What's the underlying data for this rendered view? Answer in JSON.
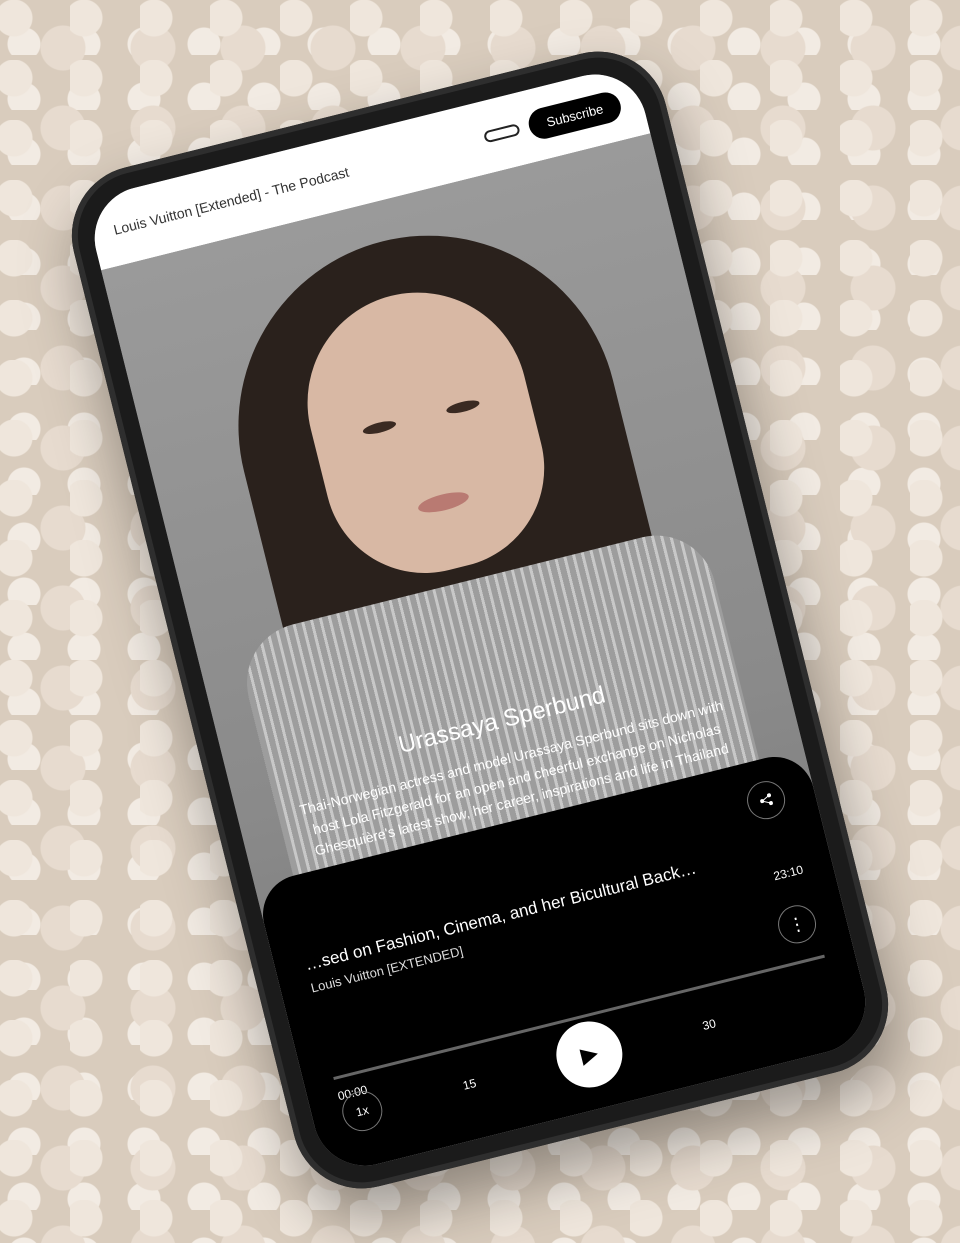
{
  "header": {
    "app_title": "Louis Vuitton [Extended] - The Podcast",
    "small_button_label": "",
    "subscribe_label": "Subscribe"
  },
  "episode": {
    "guest_name": "Urassaya Sperbund",
    "description": "Thai-Norwegian actress and model Urassaya Sperbund sits down with host Lola Fitzgerald for an open and cheerful exchange on Nicholas Ghesquière's latest show, her career, inspirations and life in Thailand"
  },
  "player": {
    "title": "…sed on Fashion, Cinema, and her Bicultural Back…",
    "show": "Louis Vuitton [EXTENDED]",
    "elapsed": "00:00",
    "duration": "23:10",
    "progress": 0,
    "speed_label": "1x",
    "rewind_label": "15",
    "forward_label": "30"
  },
  "icons": {
    "share": "share-icon",
    "menu": "more-vertical-icon",
    "play": "play-icon",
    "rewind": "rewind-15-icon",
    "forward": "forward-30-icon"
  },
  "colors": {
    "subscribe_bg": "#000000",
    "player_bg": "#000000"
  }
}
